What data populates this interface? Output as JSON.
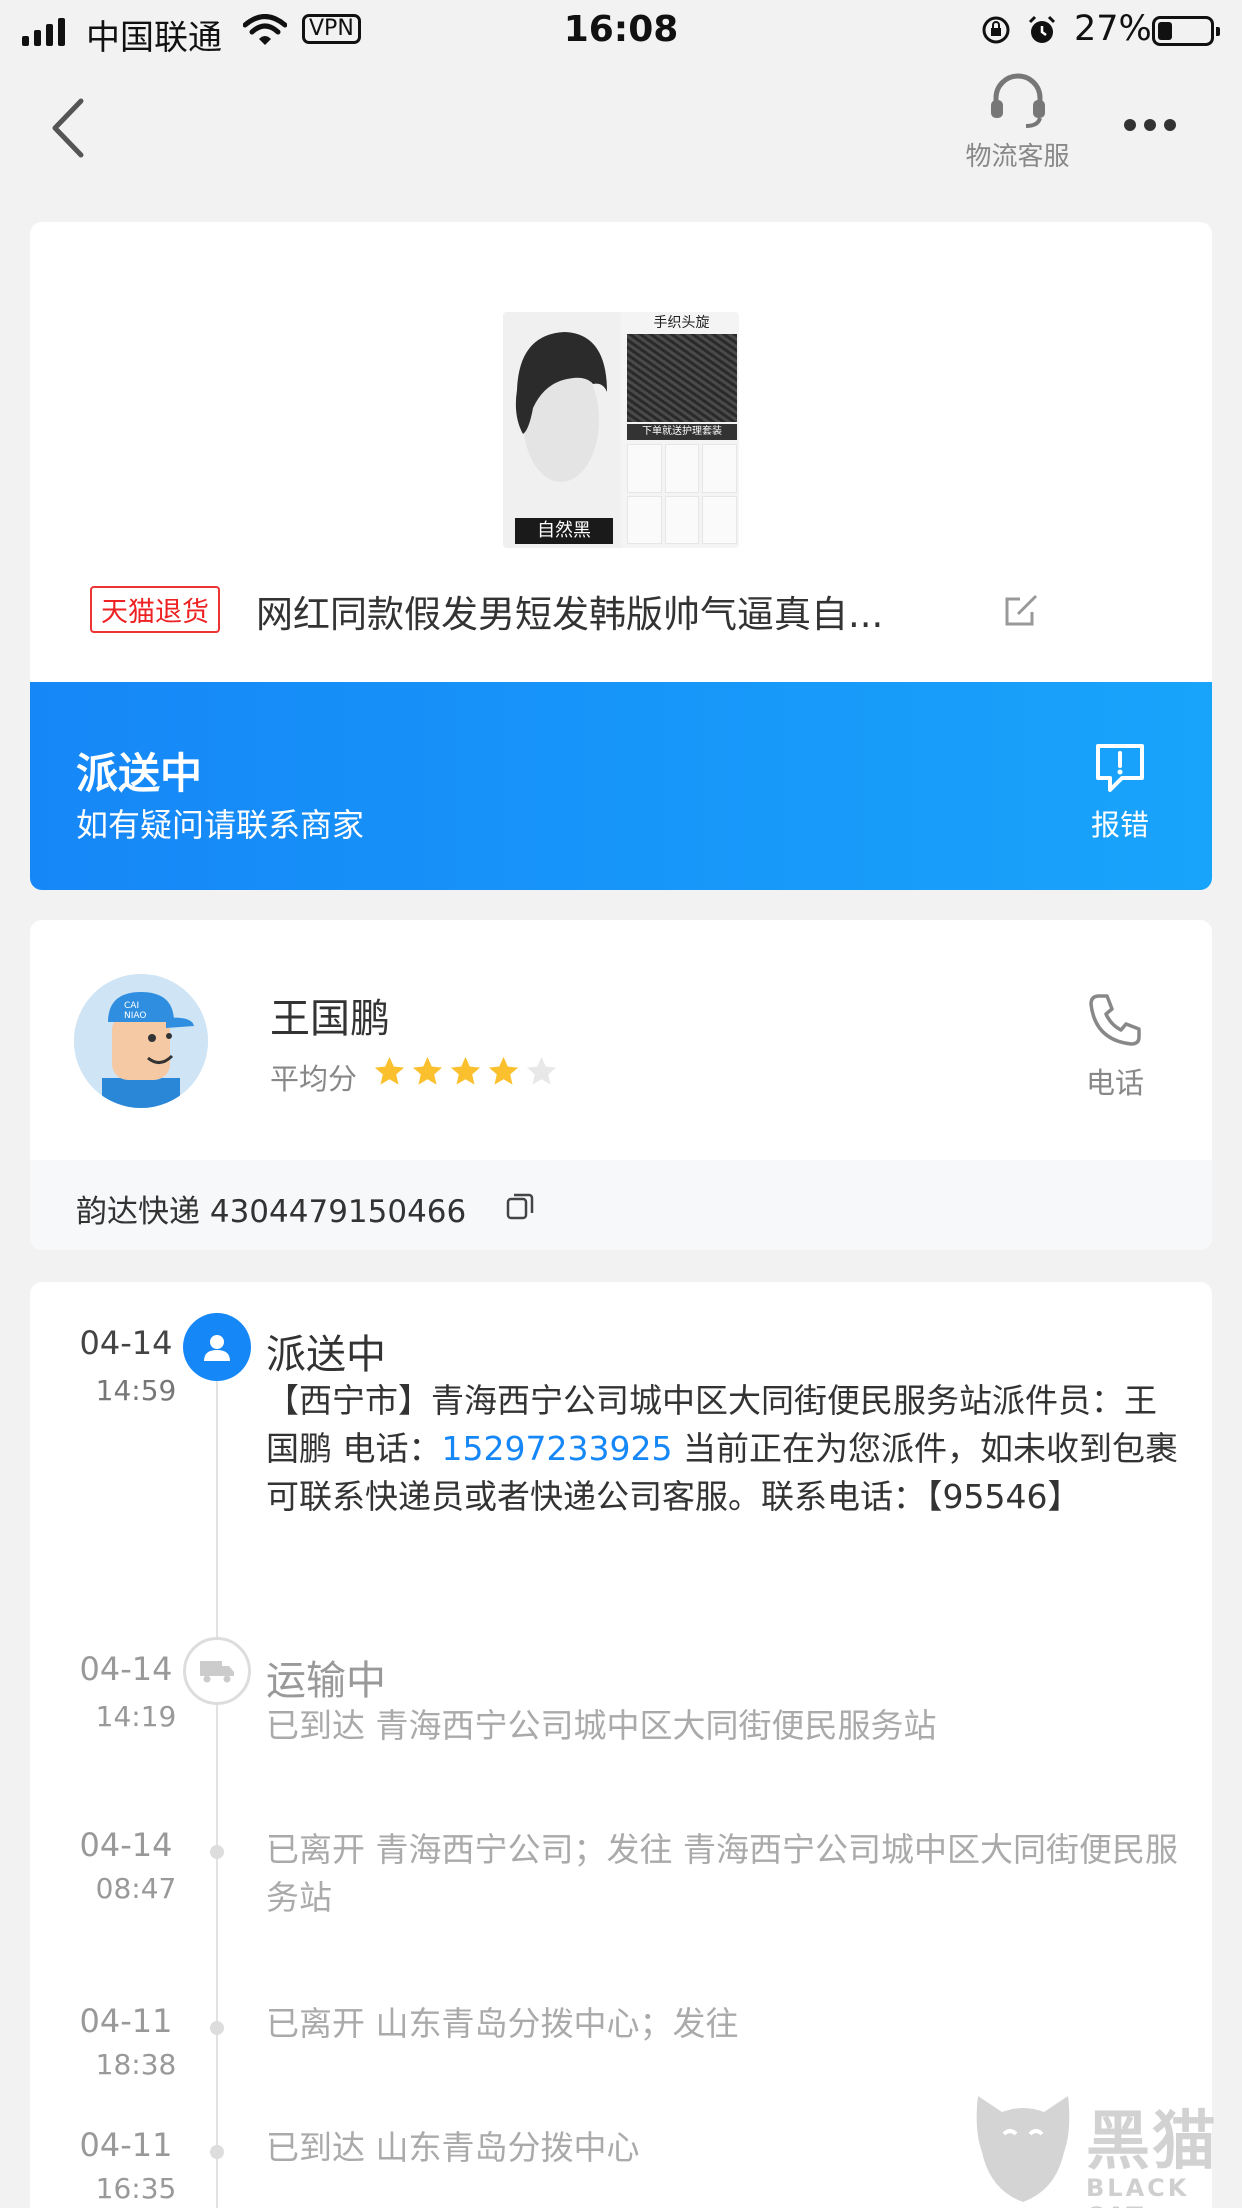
{
  "status_bar": {
    "carrier": "中国联通",
    "vpn": "VPN",
    "time": "16:08",
    "battery": "27%"
  },
  "nav": {
    "customer_service_label": "物流客服"
  },
  "product": {
    "image_label": "自然黑",
    "image_top_text": "手织头旋",
    "image_bar_text": "下单就送护理套装",
    "return_badge": "天猫退货",
    "title": "网红同款假发男短发韩版帅气逼真自..."
  },
  "status": {
    "title": "派送中",
    "subtitle": "如有疑问请联系商家",
    "report_label": "报错",
    "accent_color": "#1687f7"
  },
  "courier": {
    "name": "王国鹏",
    "avg_label": "平均分",
    "rating": 4,
    "rating_max": 5,
    "phone_label": "电话",
    "tracking": "韵达快递 4304479150466"
  },
  "timeline": [
    {
      "date": "04-14",
      "time": "14:59",
      "status": "派送中",
      "text_before": "【西宁市】青海西宁公司城中区大同街便民服务站派件员：王国鹏 电话：",
      "phone": "15297233925",
      "text_after": " 当前正在为您派件，如未收到包裹可联系快递员或者快递公司客服。联系电话：【95546】"
    },
    {
      "date": "04-14",
      "time": "14:19",
      "status": "运输中",
      "text": "已到达 青海西宁公司城中区大同街便民服务站"
    },
    {
      "date": "04-14",
      "time": "08:47",
      "text": "已离开 青海西宁公司；发往 青海西宁公司城中区大同街便民服务站"
    },
    {
      "date": "04-11",
      "time": "18:38",
      "text": "已离开 山东青岛分拨中心；发往"
    },
    {
      "date": "04-11",
      "time": "16:35",
      "text": "已到达 山东青岛分拨中心"
    }
  ],
  "watermark": {
    "title": "黑猫",
    "subtitle": "BLACK CAT"
  }
}
